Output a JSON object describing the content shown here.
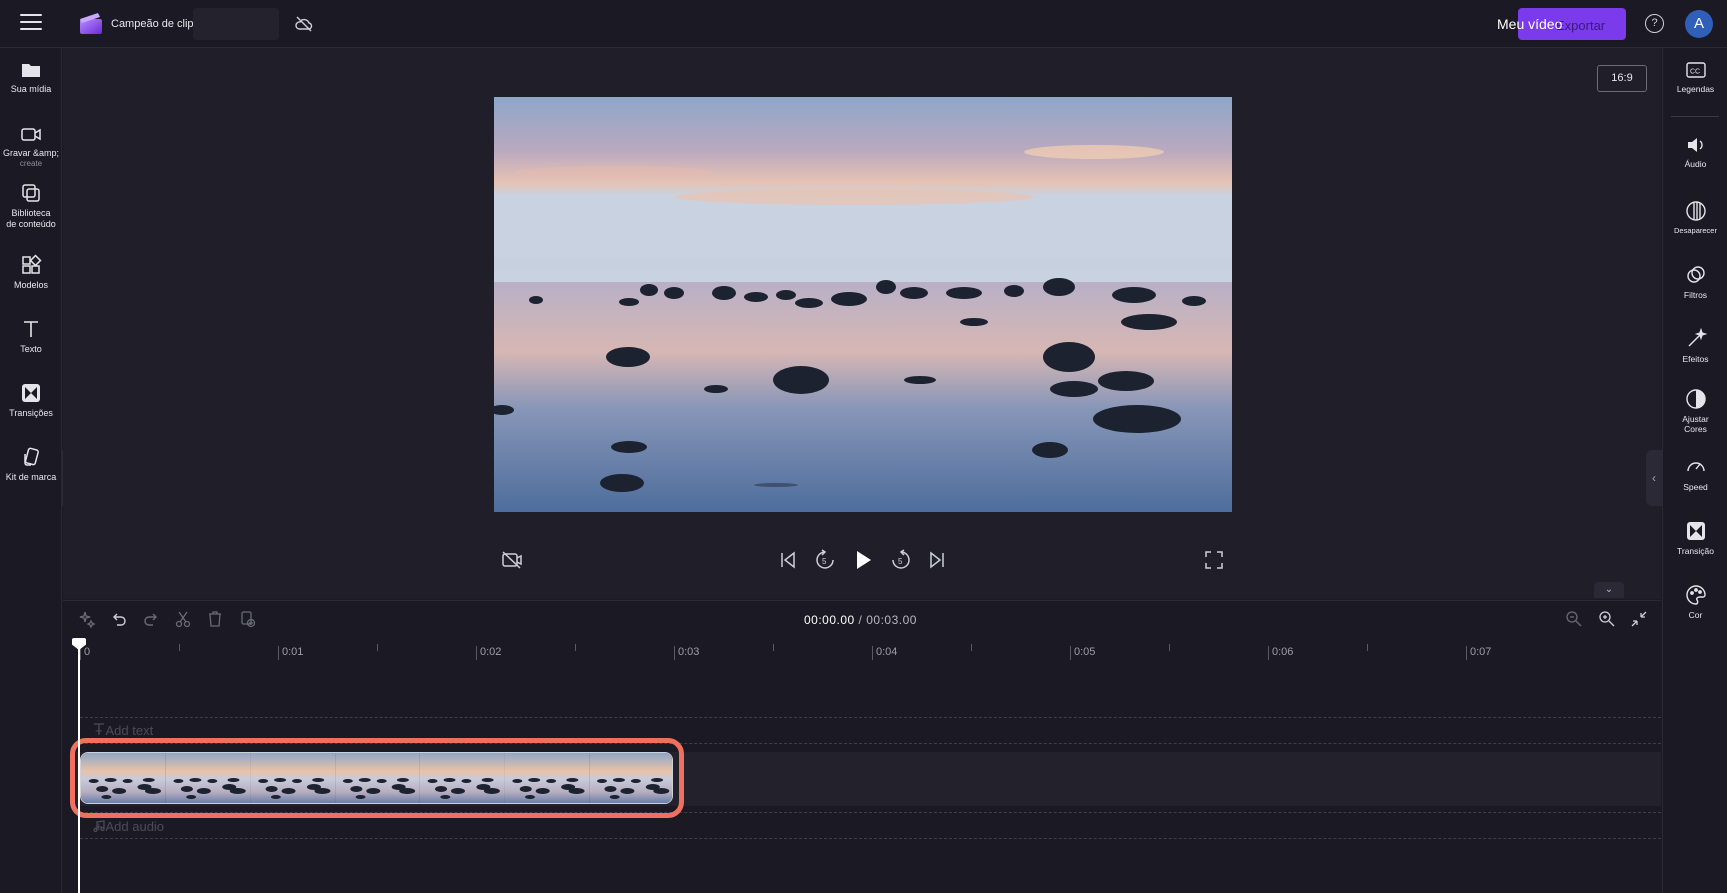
{
  "header": {
    "project_name": "Campeão de clipes",
    "video_title": "Meu vídeo",
    "export_label": "Exportar",
    "avatar_initial": "A",
    "help_glyph": "?"
  },
  "left_nav": [
    {
      "label": "Sua mídia",
      "icon": "folder-icon"
    },
    {
      "label": "Gravar &amp;",
      "sub": "create",
      "icon": "camera-icon"
    },
    {
      "label": "Biblioteca de conteúdo",
      "icon": "library-icon"
    },
    {
      "label": "Modelos",
      "icon": "templates-icon"
    },
    {
      "label": "Texto",
      "icon": "text-icon"
    },
    {
      "label": "Transições",
      "icon": "transitions-icon"
    },
    {
      "label": "Kit de marca",
      "icon": "brand-kit-icon"
    }
  ],
  "right_nav": [
    {
      "label": "Legendas",
      "icon": "captions-icon"
    },
    {
      "label": "Áudio",
      "icon": "audio-icon"
    },
    {
      "label": "Desaparecer",
      "icon": "fade-icon"
    },
    {
      "label": "Filtros",
      "icon": "filters-icon"
    },
    {
      "label": "Efeitos",
      "icon": "effects-icon"
    },
    {
      "label": "Ajustar Cores",
      "icon": "adjust-colors-icon"
    },
    {
      "label": "Speed",
      "icon": "speed-icon"
    },
    {
      "label": "Transição",
      "icon": "transition-icon"
    },
    {
      "label": "Cor",
      "icon": "color-icon"
    }
  ],
  "preview": {
    "aspect_ratio": "16:9"
  },
  "timeline": {
    "current_time": "00:00.00",
    "separator": " / ",
    "total_time": "00:03.00",
    "ticks": [
      "0",
      "0:01",
      "0:02",
      "0:03",
      "0:04",
      "0:05",
      "0:06",
      "0:07"
    ],
    "add_text_label": "+ Add text",
    "add_audio_label": "+ Add audio",
    "clip_thumbnails": 7
  },
  "colors": {
    "accent": "#7c3aed",
    "clip_highlight": "#f07060",
    "background": "#1b1a24"
  }
}
